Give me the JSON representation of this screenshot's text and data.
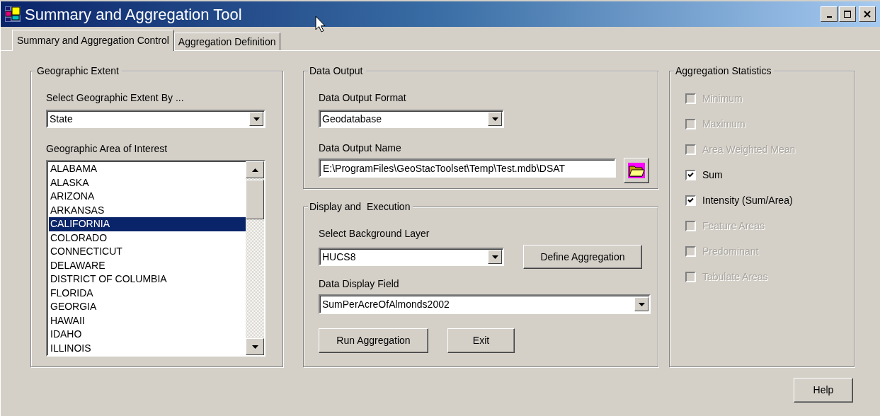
{
  "window": {
    "title": "Summary and Aggregation Tool"
  },
  "tabs": [
    {
      "label": "Summary and Aggregation Control",
      "selected": true
    },
    {
      "label": "Aggregation Definition",
      "selected": false
    }
  ],
  "geographic_extent": {
    "title": "Geographic Extent",
    "extent_label": "Select Geographic Extent By ...",
    "extent_value": "State",
    "area_label": "Geographic Area of Interest",
    "areas": [
      {
        "label": "ALABAMA",
        "selected": false
      },
      {
        "label": "ALASKA",
        "selected": false
      },
      {
        "label": "ARIZONA",
        "selected": false
      },
      {
        "label": "ARKANSAS",
        "selected": false
      },
      {
        "label": "CALIFORNIA",
        "selected": true
      },
      {
        "label": "COLORADO",
        "selected": false
      },
      {
        "label": "CONNECTICUT",
        "selected": false
      },
      {
        "label": "DELAWARE",
        "selected": false
      },
      {
        "label": "DISTRICT OF COLUMBIA",
        "selected": false
      },
      {
        "label": "FLORIDA",
        "selected": false
      },
      {
        "label": "GEORGIA",
        "selected": false
      },
      {
        "label": "HAWAII",
        "selected": false
      },
      {
        "label": "IDAHO",
        "selected": false
      },
      {
        "label": "ILLINOIS",
        "selected": false
      }
    ]
  },
  "data_output": {
    "title": "Data Output",
    "format_label": "Data Output Format",
    "format_value": "Geodatabase",
    "name_label": "Data Output Name",
    "name_value": "E:\\ProgramFiles\\GeoStacToolset\\Temp\\Test.mdb\\DSAT"
  },
  "display_execution": {
    "title": "Display and  Execution",
    "layer_label": "Select Background Layer",
    "layer_value": "HUCS8",
    "define_button": "Define Aggregation",
    "field_label": "Data Display Field",
    "field_value": "SumPerAcreOfAlmonds2002",
    "run_button": "Run Aggregation",
    "exit_button": "Exit"
  },
  "aggregation_statistics": {
    "title": "Aggregation Statistics",
    "options": [
      {
        "label": "Minimum",
        "checked": false,
        "disabled": true
      },
      {
        "label": "Maximum",
        "checked": false,
        "disabled": true
      },
      {
        "label": "Area Weighted Mean",
        "checked": false,
        "disabled": true
      },
      {
        "label": "Sum",
        "checked": true,
        "disabled": false
      },
      {
        "label": "Intensity (Sum/Area)",
        "checked": true,
        "disabled": false
      },
      {
        "label": "Feature Areas",
        "checked": false,
        "disabled": true
      },
      {
        "label": "Predominant",
        "checked": false,
        "disabled": true
      },
      {
        "label": "Tabulate Areas",
        "checked": false,
        "disabled": true
      }
    ]
  },
  "help_button": "Help"
}
